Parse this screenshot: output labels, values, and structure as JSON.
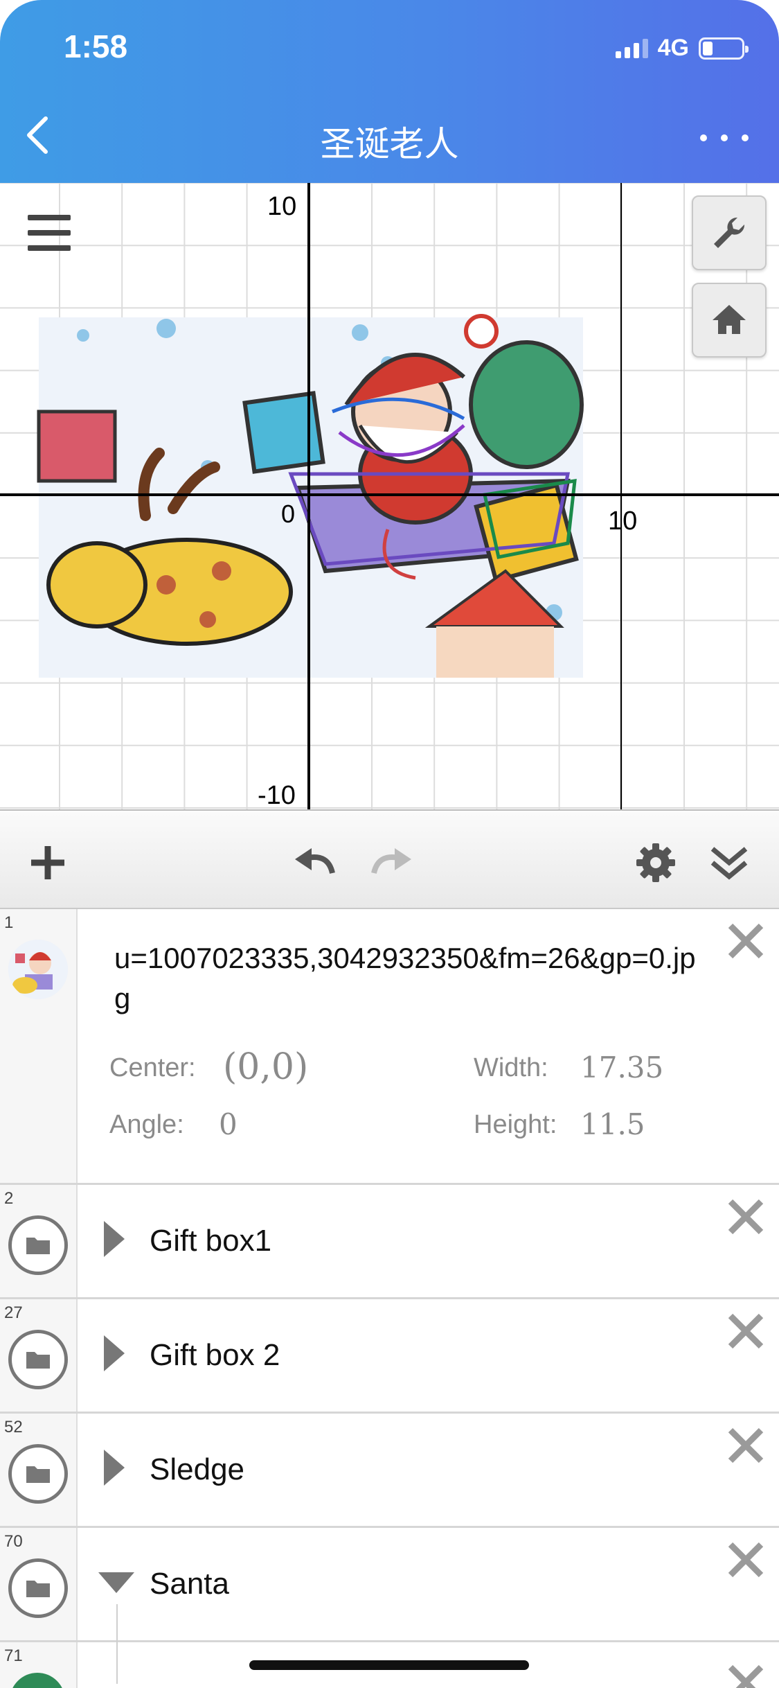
{
  "status_bar": {
    "time": "1:58",
    "network": "4G",
    "battery_level": 0.2
  },
  "nav": {
    "title": "圣诞老人",
    "back_icon": "chevron-left-icon",
    "more_icon": "ellipsis-icon"
  },
  "graph": {
    "axis_labels": {
      "x_max": "10",
      "origin": "0",
      "y_max": "10",
      "y_min": "-10"
    },
    "side_buttons": [
      "wrench-icon",
      "home-icon"
    ],
    "menu_icon": "hamburger-icon"
  },
  "toolbar": {
    "add_icon": "plus-icon",
    "undo_icon": "undo-icon",
    "redo_icon": "redo-icon",
    "settings_icon": "gear-icon",
    "collapse_icon": "double-chevron-down-icon"
  },
  "expressions": [
    {
      "number": "1",
      "type": "image",
      "name": "u=1007023335,3042932350&fm=26&gp=0.jpg",
      "center_label": "Center:",
      "center_value": "(0,0)",
      "angle_label": "Angle:",
      "angle_value": "0",
      "width_label": "Width:",
      "width_value": "17.35",
      "height_label": "Height:",
      "height_value": "11.5"
    },
    {
      "number": "2",
      "type": "folder",
      "label": "Gift box1",
      "expanded": false
    },
    {
      "number": "27",
      "type": "folder",
      "label": "Gift box 2",
      "expanded": false
    },
    {
      "number": "52",
      "type": "folder",
      "label": "Sledge",
      "expanded": false
    },
    {
      "number": "70",
      "type": "folder",
      "label": "Santa",
      "expanded": true
    },
    {
      "number": "71",
      "type": "expression"
    }
  ],
  "colors": {
    "header_start": "#3f9ce6",
    "header_end": "#5470e8",
    "grid": "#dcdcdc",
    "axis": "#000000",
    "icon_gray": "#777777"
  }
}
